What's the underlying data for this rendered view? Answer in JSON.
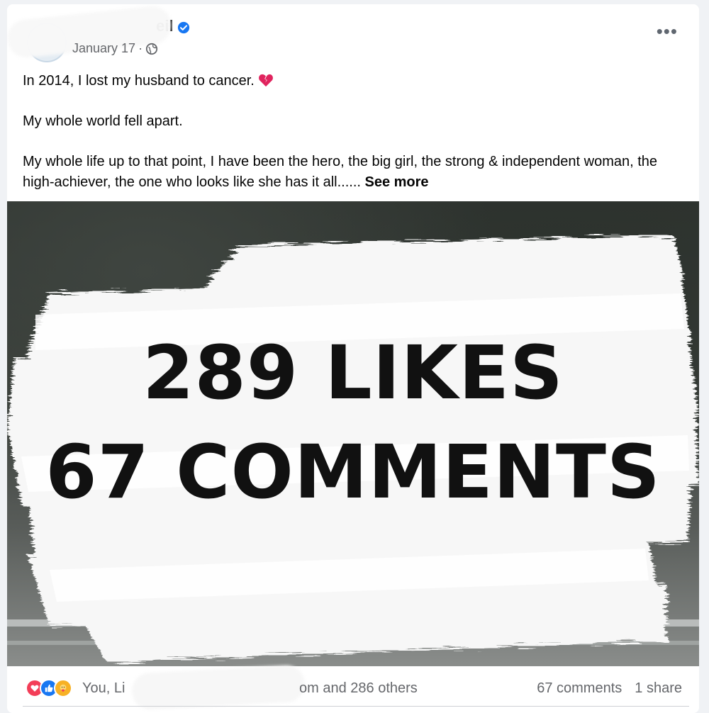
{
  "post": {
    "author_fragment": "eil",
    "date": "January 17",
    "more_label": "•••",
    "text": {
      "line1": "In 2014, I lost my husband to cancer.",
      "line2": "My whole world fell apart.",
      "line3": "My whole life up to that point, I have been the hero, the big girl, the strong & independent woman, the high-achiever, the one who looks like she has it all......",
      "see_more": "See more"
    }
  },
  "overlay": {
    "likes": "289 LIKES",
    "comments": "67 COMMENTS"
  },
  "footer": {
    "reacted_prefix": "You, Li",
    "reacted_suffix": "om and 286 others",
    "comments_count": "67 comments",
    "shares_count": "1 share"
  },
  "icons": {
    "verified": "verified-badge-icon",
    "privacy": "globe-icon",
    "emoji": "broken-heart-icon",
    "reactions": [
      "love-reaction-icon",
      "like-reaction-icon",
      "care-reaction-icon"
    ]
  },
  "colors": {
    "facebook_blue": "#1877f2",
    "love_red": "#f33e58",
    "care_yellow": "#f7b125",
    "secondary_text": "#65676b"
  }
}
